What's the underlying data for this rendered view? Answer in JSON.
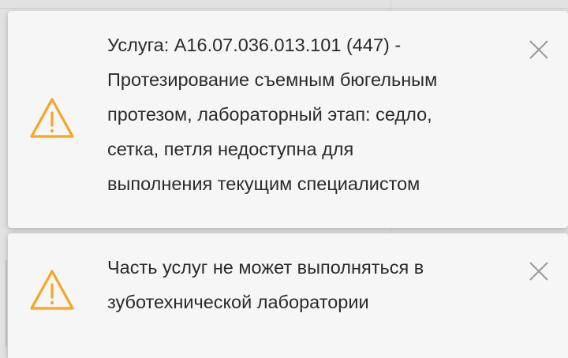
{
  "notifications": [
    {
      "icon": "warning-icon",
      "message": "Услуга: A16.07.036.013.101 (447) -\nПротезирование съемным бюгельным\nпротезом, лабораторный этап: седло,\nсетка, петля недоступна для\nвыполнения текущим специалистом",
      "close_icon": "close-icon"
    },
    {
      "icon": "warning-icon",
      "message": "Часть услуг не может выполняться в\nзуботехнической лаборатории",
      "close_icon": "close-icon"
    }
  ],
  "colors": {
    "warning": "#f5a623",
    "close": "#9a9a9a",
    "text": "#2b2b2b",
    "toast_bg": "#f6f6f6"
  }
}
